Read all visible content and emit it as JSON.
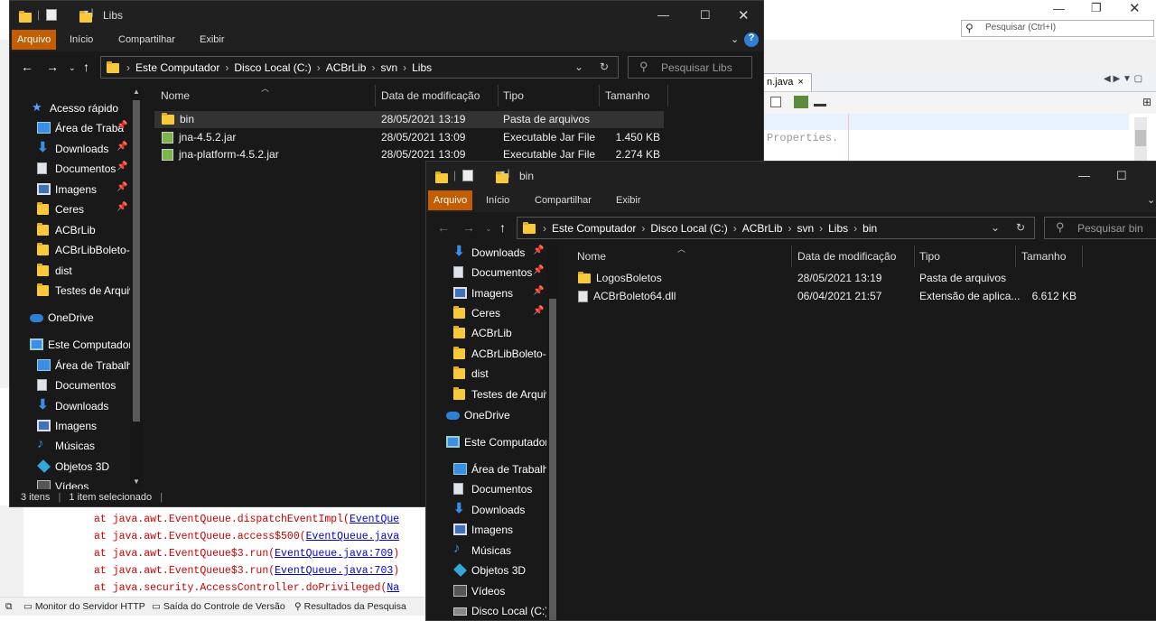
{
  "ide": {
    "search_placeholder": "Pesquisar (Ctrl+I)",
    "tab_label": "n.java",
    "tab_close": "×",
    "editor_code": "Properties.",
    "output_lines": [
      {
        "pre": "at java.awt.EventQueue.dispatchEventImpl(",
        "link": "EventQue"
      },
      {
        "pre": "at java.awt.EventQueue.access$500(",
        "link": "EventQueue.java"
      },
      {
        "pre": "at java.awt.EventQueue$3.run(",
        "link": "EventQueue.java:709",
        "post": ")"
      },
      {
        "pre": "at java.awt.EventQueue$3.run(",
        "link": "EventQueue.java:703",
        "post": ")"
      },
      {
        "pre": "at java.security.AccessController.doPrivileged(",
        "link": "Na"
      }
    ],
    "status_items": [
      "Monitor do Servidor HTTP",
      "Saída do Controle de Versão",
      "Resultados da Pesquisa"
    ]
  },
  "libs_window": {
    "title": "Libs",
    "ribbon_tabs": [
      "Arquivo",
      "Início",
      "Compartilhar",
      "Exibir"
    ],
    "address": [
      "Este Computador",
      "Disco Local (C:)",
      "ACBrLib",
      "svn",
      "Libs"
    ],
    "search_placeholder": "Pesquisar Libs",
    "columns": [
      "Nome",
      "Data de modificação",
      "Tipo",
      "Tamanho"
    ],
    "files": [
      {
        "name": "bin",
        "date": "28/05/2021 13:19",
        "type": "Pasta de arquivos",
        "size": "",
        "icon": "folder-icon",
        "selected": true
      },
      {
        "name": "jna-4.5.2.jar",
        "date": "28/05/2021 13:09",
        "type": "Executable Jar File",
        "size": "1.450 KB",
        "icon": "jar-icon",
        "selected": false
      },
      {
        "name": "jna-platform-4.5.2.jar",
        "date": "28/05/2021 13:09",
        "type": "Executable Jar File",
        "size": "2.274 KB",
        "icon": "jar-icon",
        "selected": false
      }
    ],
    "nav": [
      {
        "label": "Acesso rápido",
        "icon": "star-icon",
        "pin": false
      },
      {
        "label": "Área de Traba",
        "icon": "desktop-icon",
        "pin": true
      },
      {
        "label": "Downloads",
        "icon": "download-icon",
        "pin": true
      },
      {
        "label": "Documentos",
        "icon": "document-icon",
        "pin": true
      },
      {
        "label": "Imagens",
        "icon": "pictures-icon",
        "pin": true
      },
      {
        "label": "Ceres",
        "icon": "folder-icon",
        "pin": true
      },
      {
        "label": "ACBrLib",
        "icon": "folder-icon",
        "pin": false
      },
      {
        "label": "ACBrLibBoleto-C",
        "icon": "folder-icon",
        "pin": false
      },
      {
        "label": "dist",
        "icon": "folder-icon",
        "pin": false
      },
      {
        "label": "Testes de Arquiv",
        "icon": "folder-icon",
        "pin": false
      },
      {
        "label": "OneDrive",
        "icon": "onedrive-icon",
        "pin": false
      },
      {
        "label": "Este Computador",
        "icon": "pc-icon",
        "pin": false
      },
      {
        "label": "Área de Trabalho",
        "icon": "desktop-icon",
        "pin": false
      },
      {
        "label": "Documentos",
        "icon": "document-icon",
        "pin": false
      },
      {
        "label": "Downloads",
        "icon": "download-icon",
        "pin": false
      },
      {
        "label": "Imagens",
        "icon": "pictures-icon",
        "pin": false
      },
      {
        "label": "Músicas",
        "icon": "music-icon",
        "pin": false
      },
      {
        "label": "Objetos 3D",
        "icon": "objects3d-icon",
        "pin": false
      },
      {
        "label": "Vídeos",
        "icon": "videos-icon",
        "pin": false
      }
    ],
    "status": "3 itens",
    "status_selected": "1 item selecionado"
  },
  "bin_window": {
    "title": "bin",
    "ribbon_tabs": [
      "Arquivo",
      "Início",
      "Compartilhar",
      "Exibir"
    ],
    "address": [
      "Este Computador",
      "Disco Local (C:)",
      "ACBrLib",
      "svn",
      "Libs",
      "bin"
    ],
    "search_placeholder": "Pesquisar bin",
    "columns": [
      "Nome",
      "Data de modificação",
      "Tipo",
      "Tamanho"
    ],
    "files": [
      {
        "name": "LogosBoletos",
        "date": "28/05/2021 13:19",
        "type": "Pasta de arquivos",
        "size": "",
        "icon": "folder-icon"
      },
      {
        "name": "ACBrBoleto64.dll",
        "date": "06/04/2021 21:57",
        "type": "Extensão de aplica...",
        "size": "6.612 KB",
        "icon": "dll-icon"
      }
    ],
    "nav": [
      {
        "label": "Downloads",
        "icon": "download-icon",
        "pin": true
      },
      {
        "label": "Documentos",
        "icon": "document-icon",
        "pin": true
      },
      {
        "label": "Imagens",
        "icon": "pictures-icon",
        "pin": true
      },
      {
        "label": "Ceres",
        "icon": "folder-icon",
        "pin": true
      },
      {
        "label": "ACBrLib",
        "icon": "folder-icon",
        "pin": false
      },
      {
        "label": "ACBrLibBoleto-C",
        "icon": "folder-icon",
        "pin": false
      },
      {
        "label": "dist",
        "icon": "folder-icon",
        "pin": false
      },
      {
        "label": "Testes de Arquiv",
        "icon": "folder-icon",
        "pin": false
      },
      {
        "label": "OneDrive",
        "icon": "onedrive-icon",
        "pin": false
      },
      {
        "label": "Este Computador",
        "icon": "pc-icon",
        "pin": false
      },
      {
        "label": "Área de Trabalho",
        "icon": "desktop-icon",
        "pin": false
      },
      {
        "label": "Documentos",
        "icon": "document-icon",
        "pin": false
      },
      {
        "label": "Downloads",
        "icon": "download-icon",
        "pin": false
      },
      {
        "label": "Imagens",
        "icon": "pictures-icon",
        "pin": false
      },
      {
        "label": "Músicas",
        "icon": "music-icon",
        "pin": false
      },
      {
        "label": "Objetos 3D",
        "icon": "objects3d-icon",
        "pin": false
      },
      {
        "label": "Vídeos",
        "icon": "videos-icon",
        "pin": false
      },
      {
        "label": "Disco Local (C:)",
        "icon": "drive-icon",
        "pin": false
      }
    ]
  },
  "colors": {
    "accent": "#c25d00",
    "dark_bg": "#191919",
    "link": "#0000cc",
    "error": "#cc0000"
  }
}
